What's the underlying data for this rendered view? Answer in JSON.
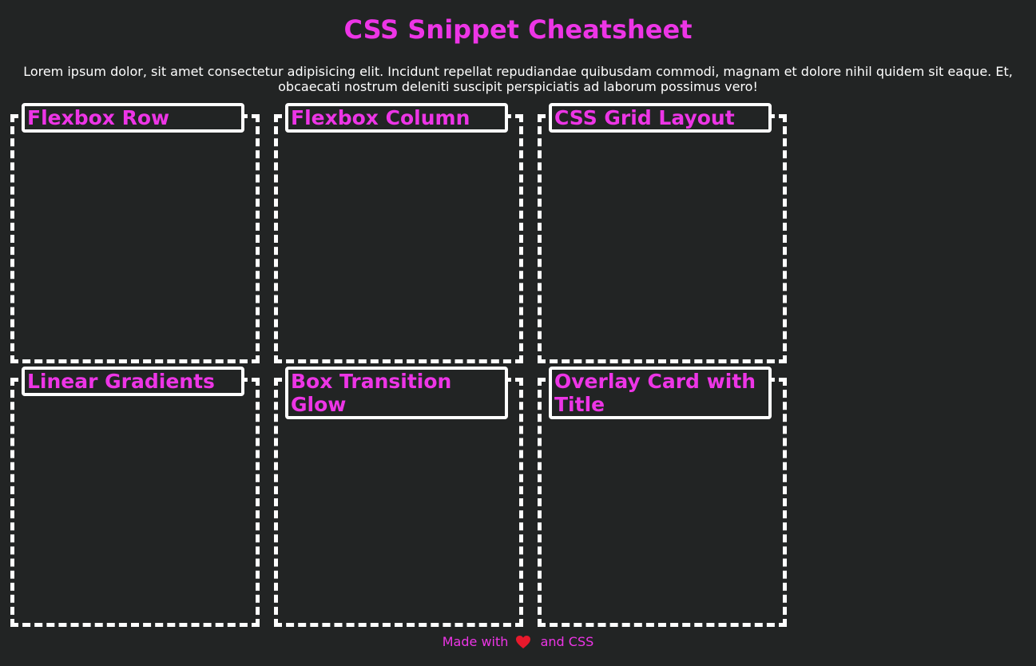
{
  "page": {
    "title": "CSS Snippet Cheatsheet",
    "intro": "Lorem ipsum dolor, sit amet consectetur adipisicing elit. Incidunt repellat repudiandae quibusdam commodi, magnam et dolore nihil quidem sit eaque. Et, obcaecati nostrum deleniti suscipit perspiciatis ad laborum possimus vero!"
  },
  "cards": [
    {
      "title": "Flexbox Row"
    },
    {
      "title": "Flexbox Column"
    },
    {
      "title": "CSS Grid Layout"
    },
    {
      "title": "Linear Gradients"
    },
    {
      "title": "Box Transition Glow"
    },
    {
      "title": "Overlay Card with Title"
    }
  ],
  "footer": {
    "prefix": "Made with",
    "icon": "heart-icon",
    "suffix": "and CSS"
  },
  "colors": {
    "background": "#222424",
    "accent": "#ed35e6",
    "border": "#ffffff",
    "heart": "#e8192c"
  }
}
